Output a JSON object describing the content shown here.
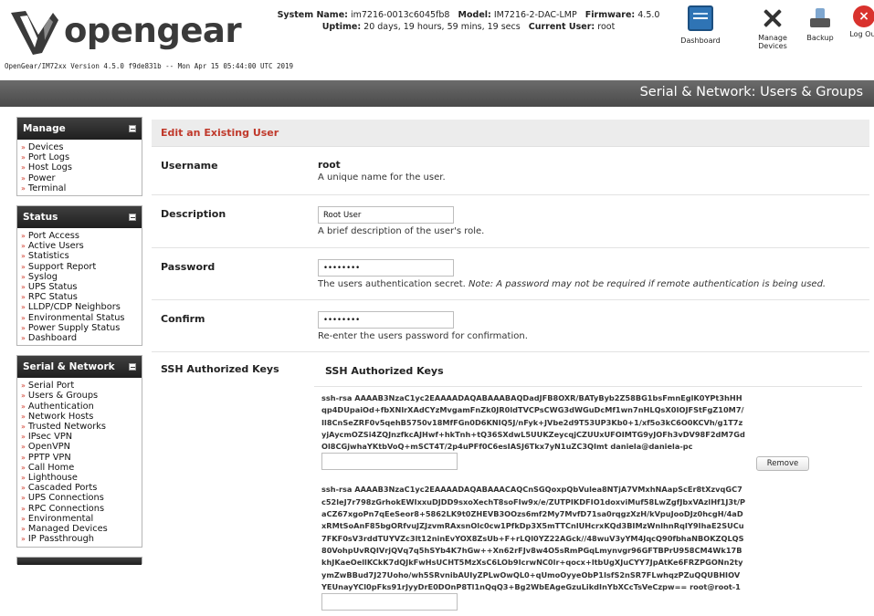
{
  "header": {
    "logo_text": "opengear",
    "version_line": "OpenGear/IM72xx Version 4.5.0 f9de831b -- Mon Apr 15 05:44:00 UTC 2019",
    "system_name_label": "System Name:",
    "system_name": "im7216-0013c6045fb8",
    "model_label": "Model:",
    "model": "IM7216-2-DAC-LMP",
    "firmware_label": "Firmware:",
    "firmware": "4.5.0",
    "uptime_label": "Uptime:",
    "uptime": "20 days, 19 hours, 59 mins, 19 secs",
    "current_user_label": "Current User:",
    "current_user": "root",
    "tools": {
      "dashboard": "Dashboard",
      "manage_devices_1": "Manage",
      "manage_devices_2": "Devices",
      "backup": "Backup",
      "logout": "Log Out"
    }
  },
  "page_title": "Serial & Network: Users & Groups",
  "sidebar": {
    "manage": {
      "title": "Manage",
      "items": [
        "Devices",
        "Port Logs",
        "Host Logs",
        "Power",
        "Terminal"
      ]
    },
    "status": {
      "title": "Status",
      "items": [
        "Port Access",
        "Active Users",
        "Statistics",
        "Support Report",
        "Syslog",
        "UPS Status",
        "RPC Status",
        "LLDP/CDP Neighbors",
        "Environmental Status",
        "Power Supply Status",
        "Dashboard"
      ]
    },
    "serial_network": {
      "title": "Serial & Network",
      "items": [
        "Serial Port",
        "Users & Groups",
        "Authentication",
        "Network Hosts",
        "Trusted Networks",
        "IPsec VPN",
        "OpenVPN",
        "PPTP VPN",
        "Call Home",
        "Lighthouse",
        "Cascaded Ports",
        "UPS Connections",
        "RPC Connections",
        "Environmental",
        "Managed Devices",
        "IP Passthrough"
      ]
    },
    "arrow": "»"
  },
  "form": {
    "section_title": "Edit an Existing User",
    "username": {
      "label": "Username",
      "value": "root",
      "hint": "A unique name for the user."
    },
    "description": {
      "label": "Description",
      "value": "Root User",
      "hint": "A brief description of the user's role."
    },
    "password": {
      "label": "Password",
      "value": "••••••••",
      "hint": "The users authentication secret.",
      "hint_note": "Note: A password may not be required if remote authentication is being used."
    },
    "confirm": {
      "label": "Confirm",
      "value": "••••••••",
      "hint": "Re-enter the users password for confirmation."
    },
    "ssh": {
      "label": "SSH Authorized Keys",
      "title": "SSH Authorized Keys",
      "remove_label": "Remove",
      "keys": [
        "ssh-rsa AAAAB3NzaC1yc2EAAAADAQABAAABAQDadJFB8OXR/BATyByb2Z58BG1bsFmnEglK0YPt3hHHqp4DUpaiOd+fbXNlrXAdCYzMvgamFnZk0JR0ldTVCPsCWG3dWGuDcMf1wn7nHLQsX0IOJFStFgZ10M7/Il8CnSeZRF0v5qehB5750v18MfFGn0D6KNIQ5J/nFyk+JVbe2d9T53UP3Kb0+1/xf5o3kC6O0KCVh/g1T7zyjAycmOZSi4ZQJnzfkcAJHwf+hkTnh+tQ36SXdwL5UUKZeycqjCZUUxUFOIMTG9yJOFh3vDV98F2dM7GdOl8CGjwhaYKtbVoQ+mSCT4T/2p4uPFf0C6esIASJ6Tkx7yN1uZC3QImt daniela@daniela-pc",
        "ssh-rsa AAAAB3NzaC1yc2EAAAADAQABAAACAQCnSGQoxpQbVulea8NTjA7VMxhNAapScEr8tXzvqGC7c52leJ7r798zGrhokEWIxxuDJDD9sxoXechT8soFIw9x/e/ZUTPIKDFIO1doxviMuf58LwZgfJbxVAzlHf1J3t/PaCZ67xgoPn7qEeSeor8+5862LK9t0ZHEVB3OOzs6mf2My7MvfD71sa0rqgzXzH/kVpuJooDJz0hcgH/4aDxRMtSoAnF85bgORfvuJZJzvmRAxsnOlc0cw1PfkDp3X5mTTCnlUHcrxKQd3BIMzWnlhnRqIY9IhaE2SUCu7FKF0sV3rddTUYVZc3lt12ninEvYOX8ZsUb+F+rLQl0YZ22AGck//48wuV3yYM4JqcQ90fbhaNBOKZQLQS80VohpUvRQIVrjQVq7q5hSYb4K7hGw++Xn62rFJv8w4O5sRmPGqLmynvgr96GFTBPrU958CM4Wk17BkhJKaeOellKCkK7dQJkFwHsUCHT5MzXsC6LOb9IcrwNC0lr+qocx+ltbUgXJuCYY7JpAtKe6FRZPGONn2tyymZwBBud7J27Uoho/wh5SRvnibAUIyZPLwOwQL0+qUmoOyyeObP1IsfS2nSR7FLwhqzPZuQQUBHIOVYEUnayYCl0pFks91rJyyDrE0DOnP8Tl1nQqQ3+Bg2WbEAgeGzuLikdInYbXCcTsVeCzpw== root@root-1"
      ]
    }
  }
}
